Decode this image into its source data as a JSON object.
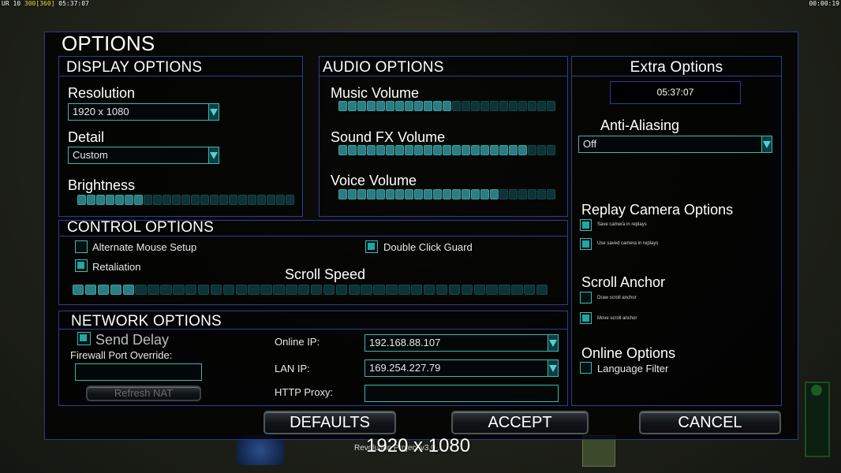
{
  "hud": {
    "left_fps_prefix": "UR 10",
    "left_fps_mid": "300",
    "left_fps_bracket": "[360]",
    "left_clock": "05:37:07",
    "right_clock": "00:00:19"
  },
  "title": "OPTIONS",
  "display": {
    "title": "DISPLAY OPTIONS",
    "resolution_label": "Resolution",
    "resolution_value": "1920 x 1080",
    "detail_label": "Detail",
    "detail_value": "Custom",
    "brightness_label": "Brightness",
    "brightness_level": 7,
    "brightness_max": 23
  },
  "audio": {
    "title": "AUDIO OPTIONS",
    "music_label": "Music Volume",
    "music_level": 12,
    "music_max": 23,
    "sfx_label": "Sound FX Volume",
    "sfx_level": 20,
    "sfx_max": 23,
    "voice_label": "Voice Volume",
    "voice_level": 17,
    "voice_max": 23
  },
  "extra": {
    "title": "Extra Options",
    "clock": "05:37:07",
    "aa_label": "Anti-Aliasing",
    "aa_value": "Off",
    "replay_title": "Replay Camera Options",
    "save_camera": "Save camera in replays",
    "save_camera_on": true,
    "use_saved_camera": "Use saved camera in replays",
    "use_saved_camera_on": true,
    "scroll_anchor_title": "Scroll Anchor",
    "draw_anchor": "Draw scroll anchor",
    "draw_anchor_on": false,
    "move_anchor": "Move scroll anchor",
    "move_anchor_on": true,
    "online_title": "Online Options",
    "language_filter": "Language Filter",
    "language_filter_on": false
  },
  "control": {
    "title": "CONTROL OPTIONS",
    "alt_mouse": "Alternate Mouse Setup",
    "alt_mouse_on": false,
    "double_click": "Double Click Guard",
    "double_click_on": true,
    "retaliation": "Retaliation",
    "retaliation_on": true,
    "scroll_speed_label": "Scroll Speed",
    "scroll_level": 5,
    "scroll_max": 38
  },
  "network": {
    "title": "NETWORK OPTIONS",
    "send_delay": "Send Delay",
    "send_delay_on": true,
    "firewall_label": "Firewall Port Override:",
    "refresh_nat": "Refresh NAT",
    "online_ip_label": "Online IP:",
    "online_ip": "192.168.88.107",
    "lan_ip_label": "LAN IP:",
    "lan_ip": "169.254.227.79",
    "http_proxy_label": "HTTP Proxy:"
  },
  "buttons": {
    "defaults": "DEFAULTS",
    "accept": "ACCEPT",
    "cancel": "CANCEL"
  },
  "footer": {
    "version_text": "Revolution Project v3.0 ...",
    "resolution_overlay": "1920 x 1080"
  }
}
